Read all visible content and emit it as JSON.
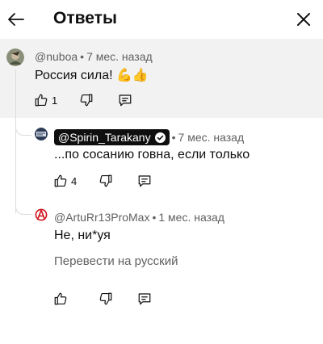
{
  "header": {
    "title": "Ответы"
  },
  "comments": [
    {
      "author": "@nuboa",
      "time": "7 мес. назад",
      "text": "Россия сила! 💪👍",
      "likes": "1"
    },
    {
      "author": "@Spirin_Tarakany",
      "time": "7 мес. назад",
      "text": "...по сосанию говна, если только",
      "likes": "4"
    },
    {
      "author": "@ArtuRr13ProMax",
      "time": "1 мес. назад",
      "text": "Не, ни*уя",
      "translate": "Перевести на русский"
    }
  ],
  "separator": "•",
  "colors": {
    "highlight_bg": "#f2f2f2",
    "text_primary": "#0f0f0f",
    "text_secondary": "#606060",
    "chip_bg": "#0f0f0f",
    "anarchy_red": "#d0121b"
  }
}
